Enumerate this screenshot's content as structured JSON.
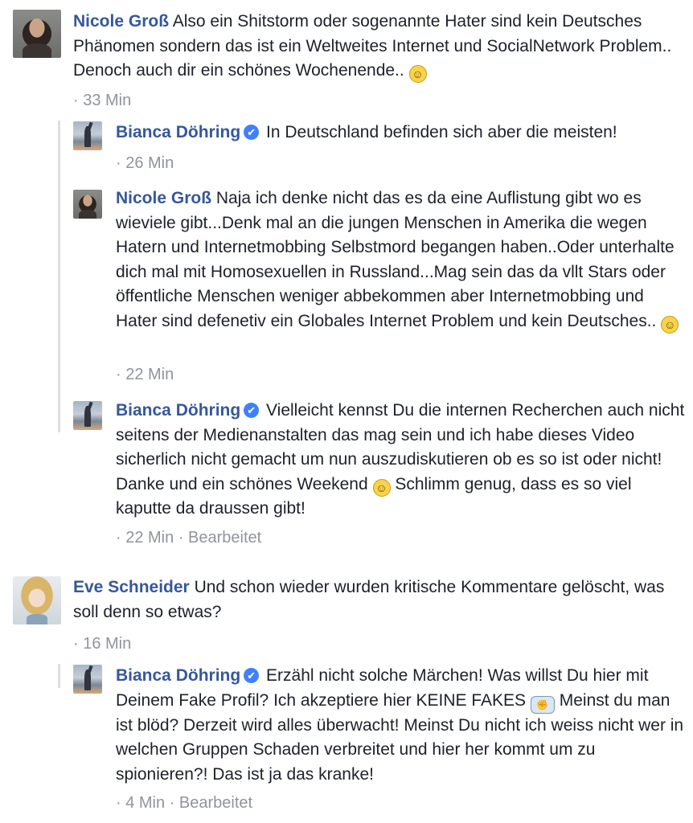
{
  "comments": [
    {
      "author": "Nicole Groß",
      "text": "Also ein Shitstorm oder sogenannte Hater sind kein Deutsches Phänomen sondern das ist ein Weltweites Internet und SocialNetwork Problem.. Denoch auch dir ein schönes Wochenende..",
      "time": "· 33 Min",
      "emoji": "slightly-smiling-face"
    },
    {
      "author": "Bianca Döhring",
      "verified": true,
      "text": "In Deutschland befinden sich aber die meisten!",
      "time": "· 26 Min"
    },
    {
      "author": "Nicole Groß",
      "text": "Naja ich denke nicht das es da eine Auflistung gibt wo es wieviele gibt...Denk mal an die jungen Menschen in Amerika die wegen Hatern und Internetmobbing Selbstmord begangen haben..Oder unterhalte dich mal mit Homosexuellen in Russland...Mag sein das da vllt Stars oder öffentliche Menschen weniger abbekommen aber Internetmobbing und Hater sind defenetiv ein Globales Internet Problem und kein Deutsches..",
      "time": "· 22 Min",
      "emoji": "slightly-smiling-face"
    },
    {
      "author": "Bianca Döhring",
      "verified": true,
      "text_before": "Vielleicht kennst Du die internen Recherchen auch nicht seitens der Medienanstalten das mag sein und ich habe dieses Video sicherlich nicht gemacht um nun auszudiskutieren ob es so ist oder nicht! Danke und ein schönes Weekend",
      "text_after": "Schlimm genug, dass es so viel kaputte da draussen gibt!",
      "time": "· 22 Min",
      "edited": "· Bearbeitet",
      "emoji": "slightly-smiling-face"
    },
    {
      "author": "Eve Schneider",
      "text": "Und schon wieder wurden kritische Kommentare gelöscht, was soll denn so etwas?",
      "time": "· 16 Min"
    },
    {
      "author": "Bianca Döhring",
      "verified": true,
      "text_before": "Erzähl nicht solche Märchen! Was willst Du hier mit Deinem Fake Profil? Ich akzeptiere hier KEINE FAKES",
      "text_after": "Meinst du man ist blöd? Derzeit wird alles überwacht! Meinst Du nicht ich weiss nicht wer in welchen Gruppen Schaden verbreitet und hier her kommt um zu spionieren?! Das ist ja das kranke!",
      "time": "· 4 Min",
      "edited": "· Bearbeitet",
      "emoji": "fist-bump"
    }
  ],
  "icons": {
    "verified": "✔",
    "smile": "☺",
    "fist": "✊"
  }
}
